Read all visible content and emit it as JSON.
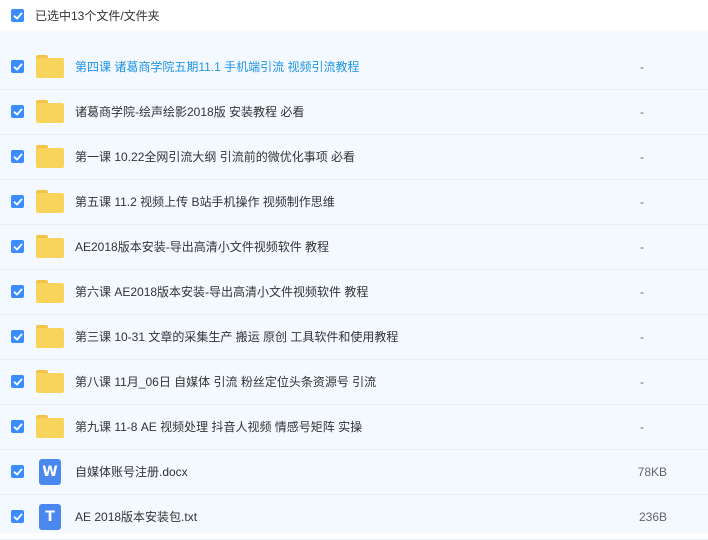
{
  "header": {
    "selection_text": "已选中13个文件/文件夹"
  },
  "colors": {
    "checkbox": "#3b8cff",
    "link": "#1f94e6",
    "folder": "#f9d45c",
    "row_bg": "#f4f9ff"
  },
  "files": [
    {
      "name": "第四课 诸葛商学院五期11.1 手机端引流 视频引流教程",
      "size": "-",
      "type": "folder",
      "highlight": true
    },
    {
      "name": "诸葛商学院-绘声绘影2018版 安装教程 必看",
      "size": "-",
      "type": "folder"
    },
    {
      "name": "第一课 10.22全网引流大纲 引流前的微优化事项 必看",
      "size": "-",
      "type": "folder"
    },
    {
      "name": "第五课 11.2 视频上传 B站手机操作 视频制作思维",
      "size": "-",
      "type": "folder"
    },
    {
      "name": "AE2018版本安装-导出高清小文件视频软件 教程",
      "size": "-",
      "type": "folder"
    },
    {
      "name": "第六课 AE2018版本安装-导出高清小文件视频软件 教程",
      "size": "-",
      "type": "folder"
    },
    {
      "name": "第三课 10-31 文章的采集生产 搬运 原创 工具软件和使用教程",
      "size": "-",
      "type": "folder"
    },
    {
      "name": "第八课 11月_06日 自媒体 引流 粉丝定位头条资源号 引流",
      "size": "-",
      "type": "folder"
    },
    {
      "name": "第九课 11-8 AE 视频处理 抖音人视频 情感号矩阵 实操",
      "size": "-",
      "type": "folder"
    },
    {
      "name": "自媒体账号注册.docx",
      "size": "78KB",
      "type": "docx",
      "icon_letter": "W"
    },
    {
      "name": "AE 2018版本安装包.txt",
      "size": "236B",
      "type": "txt",
      "icon_letter": "T"
    }
  ]
}
